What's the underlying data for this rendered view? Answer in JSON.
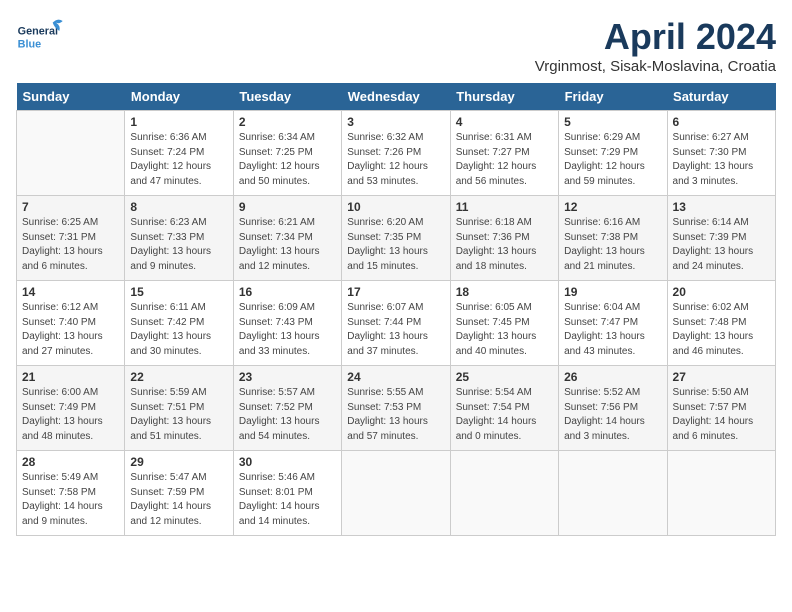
{
  "header": {
    "logo_general": "General",
    "logo_blue": "Blue",
    "month_title": "April 2024",
    "location": "Vrginmost, Sisak-Moslavina, Croatia"
  },
  "weekdays": [
    "Sunday",
    "Monday",
    "Tuesday",
    "Wednesday",
    "Thursday",
    "Friday",
    "Saturday"
  ],
  "weeks": [
    [
      {
        "day": "",
        "info": ""
      },
      {
        "day": "1",
        "info": "Sunrise: 6:36 AM\nSunset: 7:24 PM\nDaylight: 12 hours\nand 47 minutes."
      },
      {
        "day": "2",
        "info": "Sunrise: 6:34 AM\nSunset: 7:25 PM\nDaylight: 12 hours\nand 50 minutes."
      },
      {
        "day": "3",
        "info": "Sunrise: 6:32 AM\nSunset: 7:26 PM\nDaylight: 12 hours\nand 53 minutes."
      },
      {
        "day": "4",
        "info": "Sunrise: 6:31 AM\nSunset: 7:27 PM\nDaylight: 12 hours\nand 56 minutes."
      },
      {
        "day": "5",
        "info": "Sunrise: 6:29 AM\nSunset: 7:29 PM\nDaylight: 12 hours\nand 59 minutes."
      },
      {
        "day": "6",
        "info": "Sunrise: 6:27 AM\nSunset: 7:30 PM\nDaylight: 13 hours\nand 3 minutes."
      }
    ],
    [
      {
        "day": "7",
        "info": "Sunrise: 6:25 AM\nSunset: 7:31 PM\nDaylight: 13 hours\nand 6 minutes."
      },
      {
        "day": "8",
        "info": "Sunrise: 6:23 AM\nSunset: 7:33 PM\nDaylight: 13 hours\nand 9 minutes."
      },
      {
        "day": "9",
        "info": "Sunrise: 6:21 AM\nSunset: 7:34 PM\nDaylight: 13 hours\nand 12 minutes."
      },
      {
        "day": "10",
        "info": "Sunrise: 6:20 AM\nSunset: 7:35 PM\nDaylight: 13 hours\nand 15 minutes."
      },
      {
        "day": "11",
        "info": "Sunrise: 6:18 AM\nSunset: 7:36 PM\nDaylight: 13 hours\nand 18 minutes."
      },
      {
        "day": "12",
        "info": "Sunrise: 6:16 AM\nSunset: 7:38 PM\nDaylight: 13 hours\nand 21 minutes."
      },
      {
        "day": "13",
        "info": "Sunrise: 6:14 AM\nSunset: 7:39 PM\nDaylight: 13 hours\nand 24 minutes."
      }
    ],
    [
      {
        "day": "14",
        "info": "Sunrise: 6:12 AM\nSunset: 7:40 PM\nDaylight: 13 hours\nand 27 minutes."
      },
      {
        "day": "15",
        "info": "Sunrise: 6:11 AM\nSunset: 7:42 PM\nDaylight: 13 hours\nand 30 minutes."
      },
      {
        "day": "16",
        "info": "Sunrise: 6:09 AM\nSunset: 7:43 PM\nDaylight: 13 hours\nand 33 minutes."
      },
      {
        "day": "17",
        "info": "Sunrise: 6:07 AM\nSunset: 7:44 PM\nDaylight: 13 hours\nand 37 minutes."
      },
      {
        "day": "18",
        "info": "Sunrise: 6:05 AM\nSunset: 7:45 PM\nDaylight: 13 hours\nand 40 minutes."
      },
      {
        "day": "19",
        "info": "Sunrise: 6:04 AM\nSunset: 7:47 PM\nDaylight: 13 hours\nand 43 minutes."
      },
      {
        "day": "20",
        "info": "Sunrise: 6:02 AM\nSunset: 7:48 PM\nDaylight: 13 hours\nand 46 minutes."
      }
    ],
    [
      {
        "day": "21",
        "info": "Sunrise: 6:00 AM\nSunset: 7:49 PM\nDaylight: 13 hours\nand 48 minutes."
      },
      {
        "day": "22",
        "info": "Sunrise: 5:59 AM\nSunset: 7:51 PM\nDaylight: 13 hours\nand 51 minutes."
      },
      {
        "day": "23",
        "info": "Sunrise: 5:57 AM\nSunset: 7:52 PM\nDaylight: 13 hours\nand 54 minutes."
      },
      {
        "day": "24",
        "info": "Sunrise: 5:55 AM\nSunset: 7:53 PM\nDaylight: 13 hours\nand 57 minutes."
      },
      {
        "day": "25",
        "info": "Sunrise: 5:54 AM\nSunset: 7:54 PM\nDaylight: 14 hours\nand 0 minutes."
      },
      {
        "day": "26",
        "info": "Sunrise: 5:52 AM\nSunset: 7:56 PM\nDaylight: 14 hours\nand 3 minutes."
      },
      {
        "day": "27",
        "info": "Sunrise: 5:50 AM\nSunset: 7:57 PM\nDaylight: 14 hours\nand 6 minutes."
      }
    ],
    [
      {
        "day": "28",
        "info": "Sunrise: 5:49 AM\nSunset: 7:58 PM\nDaylight: 14 hours\nand 9 minutes."
      },
      {
        "day": "29",
        "info": "Sunrise: 5:47 AM\nSunset: 7:59 PM\nDaylight: 14 hours\nand 12 minutes."
      },
      {
        "day": "30",
        "info": "Sunrise: 5:46 AM\nSunset: 8:01 PM\nDaylight: 14 hours\nand 14 minutes."
      },
      {
        "day": "",
        "info": ""
      },
      {
        "day": "",
        "info": ""
      },
      {
        "day": "",
        "info": ""
      },
      {
        "day": "",
        "info": ""
      }
    ]
  ]
}
